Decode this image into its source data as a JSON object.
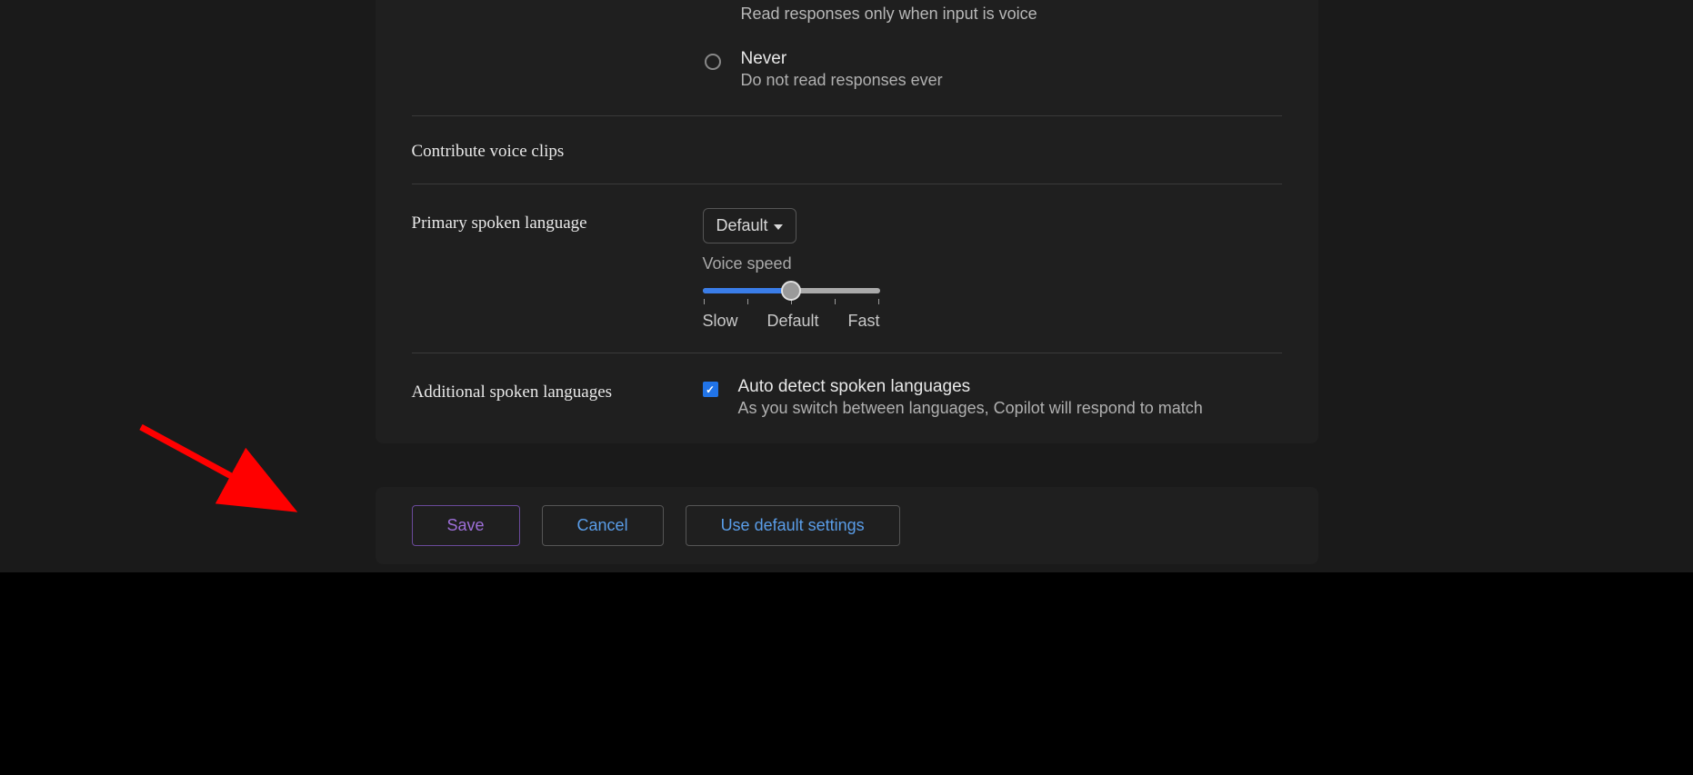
{
  "topOption": {
    "desc": "Read responses only when input is voice"
  },
  "neverOption": {
    "label": "Never",
    "desc": "Do not read responses ever"
  },
  "contributeSection": {
    "title": "Contribute voice clips"
  },
  "primaryLang": {
    "label": "Primary spoken language",
    "dropdown": "Default",
    "voiceSpeedLabel": "Voice speed",
    "speedSlow": "Slow",
    "speedDefault": "Default",
    "speedFast": "Fast"
  },
  "additionalLang": {
    "label": "Additional spoken languages",
    "checkLabel": "Auto detect spoken languages",
    "checkDesc": "As you switch between languages, Copilot will respond to match"
  },
  "buttons": {
    "save": "Save",
    "cancel": "Cancel",
    "useDefault": "Use default settings"
  }
}
